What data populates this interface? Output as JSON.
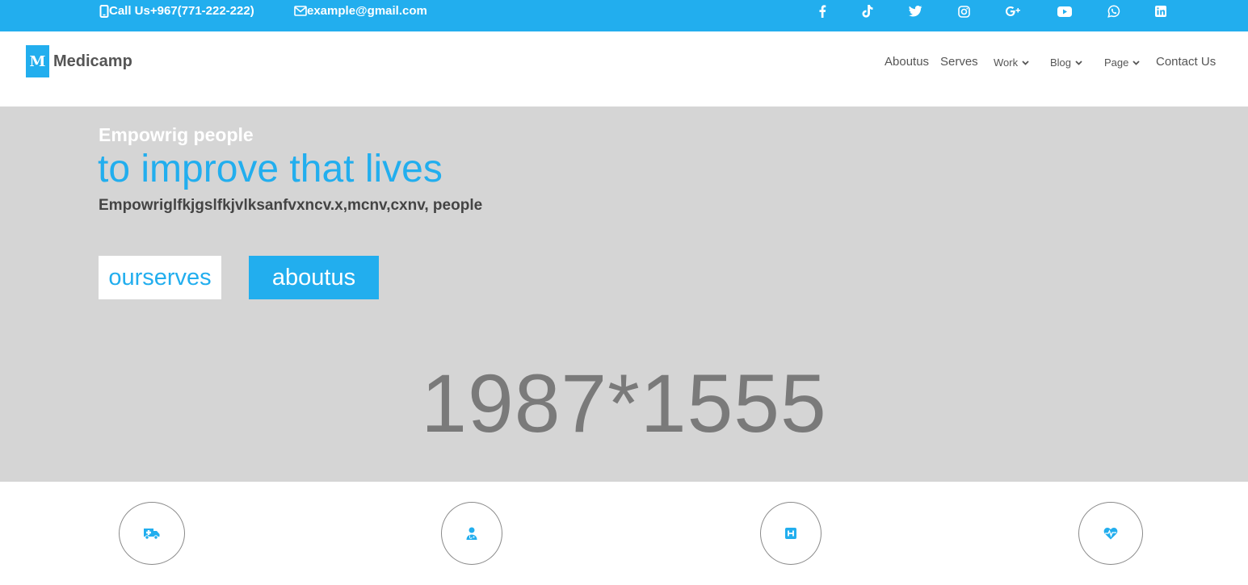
{
  "topbar": {
    "phone_text": "Call Us+967(771-222-222)",
    "email_text": "example@gmail.com",
    "social_icons": [
      "facebook-icon",
      "tiktok-icon",
      "twitter-icon",
      "instagram-icon",
      "google-plus-icon",
      "youtube-icon",
      "whatsapp-icon",
      "linkedin-icon"
    ]
  },
  "header": {
    "logo_letter": "M",
    "logo_text": "Medicamp",
    "nav": {
      "aboutus": "Aboutus",
      "serves": "Serves",
      "work": "Work",
      "blog": "Blog",
      "page": "Page",
      "contact": "Contact Us"
    }
  },
  "hero": {
    "kicker": "Empowrig people",
    "title": "to improve that lives",
    "subtitle": "Empowriglfkjgslfkjvlksanfvxncv.x,mcnv,cxnv, people",
    "btn_serves": "ourserves",
    "btn_about": "aboutus",
    "image_placeholder": "1987*1555"
  },
  "features": {
    "icons": [
      "ambulance-icon",
      "doctor-icon",
      "hospital-icon",
      "heartbeat-icon"
    ]
  },
  "colors": {
    "accent": "#22aeee",
    "hero_bg": "#d5d5d5"
  }
}
